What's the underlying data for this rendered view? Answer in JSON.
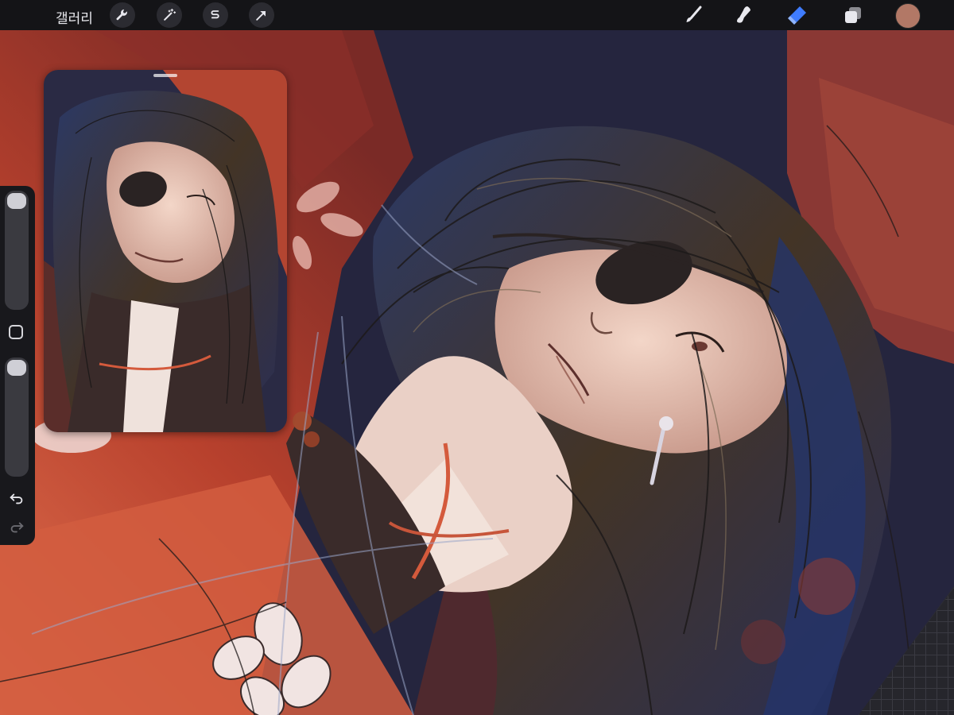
{
  "toolbar": {
    "gallery_label": "갤러리",
    "left_tools": [
      {
        "name": "actions",
        "icon": "wrench-icon"
      },
      {
        "name": "adjustments",
        "icon": "magic-wand-icon"
      },
      {
        "name": "selection",
        "icon": "selection-s-icon"
      },
      {
        "name": "transform",
        "icon": "arrow-cursor-icon"
      }
    ],
    "right_tools": [
      {
        "name": "brush",
        "icon": "brush-icon"
      },
      {
        "name": "smudge",
        "icon": "smudge-icon"
      },
      {
        "name": "eraser",
        "icon": "eraser-icon",
        "active": true
      },
      {
        "name": "layers",
        "icon": "layers-icon"
      }
    ],
    "color_swatch": "#b27866",
    "active_color": "#3f7cff"
  },
  "sidebar": {
    "brush_size_icon": "slider-handle",
    "modify_icon": "square-icon",
    "undo_icon": "undo-arrow-icon",
    "redo_icon": "redo-arrow-icon"
  },
  "canvas": {
    "palette": {
      "background_red": "#b0432f",
      "background_dark": "#24243c",
      "hair": "#3b2f25",
      "skin": "#e9c2b4"
    }
  }
}
